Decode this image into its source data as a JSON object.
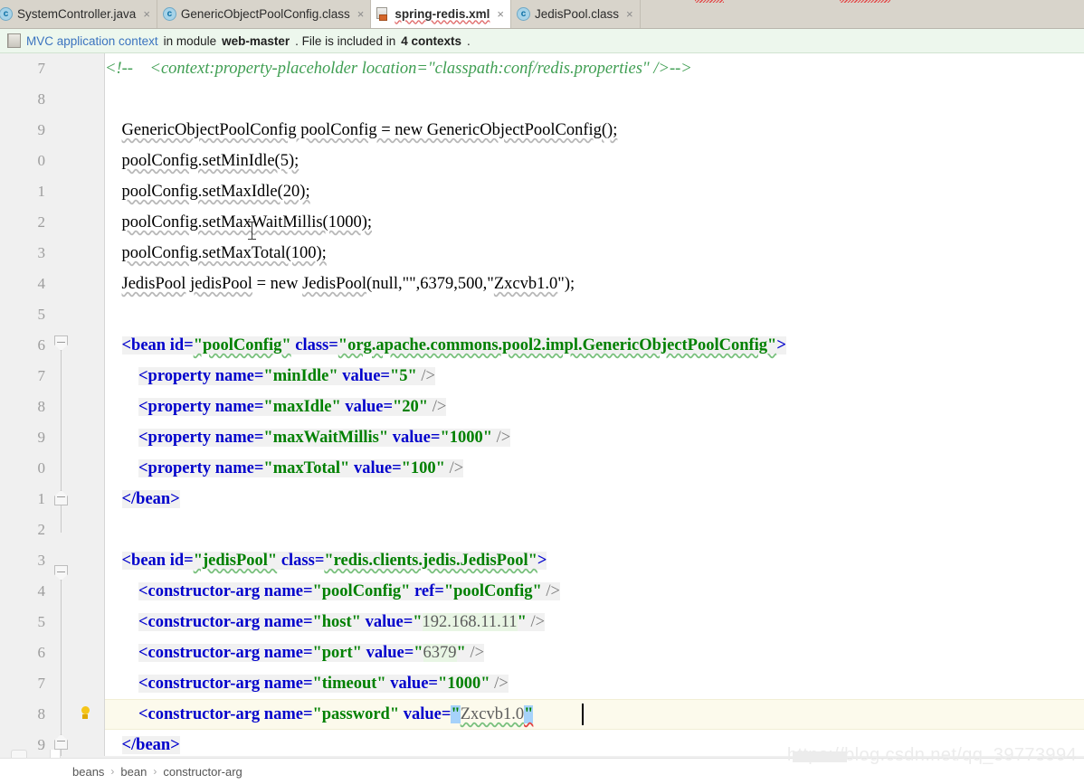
{
  "tabs": [
    {
      "label": "SystemController.java",
      "icon": "java-class-icon",
      "active": false
    },
    {
      "label": "GenericObjectPoolConfig.class",
      "icon": "java-class-icon",
      "active": false
    },
    {
      "label": "spring-redis.xml",
      "icon": "xml-file-icon",
      "active": true
    },
    {
      "label": "JedisPool.class",
      "icon": "java-class-icon",
      "active": false
    }
  ],
  "tab_close_glyph": "×",
  "banner": {
    "icon": "module-icon",
    "link_text": "MVC application context",
    "text_mid": " in module ",
    "module_name": "web-master",
    "text_mid2": ". File is included in ",
    "contexts_count": "4 contexts",
    "text_end": "."
  },
  "line_numbers": [
    "7",
    "8",
    "9",
    "0",
    "1",
    "2",
    "3",
    "4",
    "5",
    "6",
    "7",
    "8",
    "9",
    "0",
    "1",
    "2",
    "3",
    "4",
    "5",
    "6",
    "7",
    "8",
    "9"
  ],
  "code_lines": [
    {
      "n": "7",
      "text": "<!--    <context:property-placeholder location=\"classpath:conf/redis.properties\" />-->"
    },
    {
      "n": "8",
      "text": ""
    },
    {
      "n": "9",
      "text": "    GenericObjectPoolConfig poolConfig = new GenericObjectPoolConfig();"
    },
    {
      "n": "0",
      "text": "    poolConfig.setMinIdle(5);"
    },
    {
      "n": "1",
      "text": "    poolConfig.setMaxIdle(20);"
    },
    {
      "n": "2",
      "text": "    poolConfig.setMaxWaitMillis(1000);"
    },
    {
      "n": "3",
      "text": "    poolConfig.setMaxTotal(100);"
    },
    {
      "n": "4",
      "text": "    JedisPool jedisPool = new JedisPool(null,\"\",6379,500,\"Zxcvb1.0\");"
    },
    {
      "n": "5",
      "text": ""
    },
    {
      "n": "6",
      "text": "    <bean id=\"poolConfig\" class=\"org.apache.commons.pool2.impl.GenericObjectPoolConfig\">"
    },
    {
      "n": "7",
      "text": "        <property name=\"minIdle\" value=\"5\" />"
    },
    {
      "n": "8",
      "text": "        <property name=\"maxIdle\" value=\"20\" />"
    },
    {
      "n": "9",
      "text": "        <property name=\"maxWaitMillis\" value=\"1000\" />"
    },
    {
      "n": "0",
      "text": "        <property name=\"maxTotal\" value=\"100\" />"
    },
    {
      "n": "1",
      "text": "    </bean>"
    },
    {
      "n": "2",
      "text": ""
    },
    {
      "n": "3",
      "text": "    <bean id=\"jedisPool\" class=\"redis.clients.jedis.JedisPool\">"
    },
    {
      "n": "4",
      "text": "        <constructor-arg name=\"poolConfig\" ref=\"poolConfig\" />"
    },
    {
      "n": "5",
      "text": "        <constructor-arg name=\"host\" value=\"192.168.11.11\" />"
    },
    {
      "n": "6",
      "text": "        <constructor-arg name=\"port\" value=\"6379\" />"
    },
    {
      "n": "7",
      "text": "        <constructor-arg name=\"timeout\" value=\"1000\" />"
    },
    {
      "n": "8",
      "text": "        <constructor-arg name=\"password\" value=\"Zxcvb1.0\""
    },
    {
      "n": "9",
      "text": "    </bean>"
    }
  ],
  "tokens": {
    "comment_open": "<!--",
    "comment_body": "<context:property-placeholder location=\"classpath:conf/redis.properties\" />-->",
    "java_l9_a": "GenericObjectPoolConfig poolConfig = new GenericObjectPoolConfig();",
    "java_l10": "poolConfig.setMinIdle(5);",
    "java_l11": "poolConfig.setMaxIdle(20);",
    "java_l12": "poolConfig.setMaxWaitMillis(1000);",
    "java_l13": "poolConfig.setMaxTotal(100);",
    "java_l14_a": "JedisPool",
    "java_l14_b": " ",
    "java_l14_c": "jedisPool",
    "java_l14_d": " = new ",
    "java_l14_e": "JedisPool",
    "java_l14_f": "(null,\"\",6379,500,\"",
    "java_l14_g": "Zxcvb1.0",
    "java_l14_h": "\");",
    "bean_open_tag": "<bean ",
    "attr_id": "id=",
    "val_poolConfig": "\"poolConfig\"",
    "attr_class": " class=",
    "val_poolConfigClass": "\"org.apache.commons.pool2.impl.GenericObjectPoolConfig\"",
    "gt": ">",
    "prop_tag": "<property ",
    "attr_name": "name=",
    "attr_value": " value=",
    "val_minIdle": "\"minIdle\"",
    "val_5": "\"5\"",
    "val_maxIdle": "\"maxIdle\"",
    "val_20": "\"20\"",
    "val_maxWaitMillis": "\"maxWaitMillis\"",
    "val_1000": "\"1000\"",
    "val_maxTotal": "\"maxTotal\"",
    "val_100": "\"100\"",
    "selfclose": " />",
    "bean_close": "</bean>",
    "val_jedisPool": "\"jedisPool\"",
    "val_jedisPoolClass": "\"redis.clients.jedis.JedisPool\"",
    "ctor_tag": "<constructor-arg ",
    "val_poolConfigName": "\"poolConfig\"",
    "attr_ref": " ref=",
    "val_host": "\"host\"",
    "val_ip": "192.168.11.11",
    "val_port": "\"port\"",
    "val_6379": "6379",
    "val_timeout": "\"timeout\"",
    "val_password": "\"password\"",
    "val_zxcvb": "Zxcvb1.0",
    "quote": "\"",
    "eq": "="
  },
  "gutter": {
    "fold_markers": [
      {
        "line": "6",
        "state": "open"
      },
      {
        "line": "1",
        "state": "close"
      },
      {
        "line": "3",
        "state": "open"
      },
      {
        "line": "9",
        "state": "close"
      }
    ],
    "bulb_line": "8"
  },
  "breadcrumb": [
    "beans",
    "bean",
    "constructor-arg"
  ],
  "breadcrumb_sep": "›",
  "watermark": "https://blog.csdn.net/qq_39773994",
  "colors": {
    "tab_bar_bg": "#d8d4cb",
    "active_tab_bg": "#ffffff",
    "banner_bg": "#edf7ed",
    "gutter_bg": "#f0f0f0",
    "editor_bg": "#ffffff",
    "xml_block_bg": "#f1f1f1",
    "current_line_bg": "#fcfaec",
    "selection_bg": "#a6d2fa",
    "comment_color": "#3f9e52",
    "tag_color": "#0000cc",
    "value_color": "#008000",
    "link_color": "#3b73bf",
    "watermark_color": "#ececec"
  }
}
